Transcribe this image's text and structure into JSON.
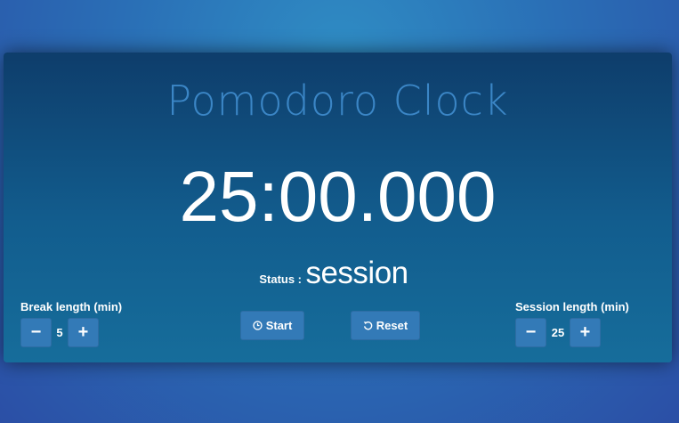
{
  "app": {
    "title": "Pomodoro Clock",
    "timer": "25:00.000"
  },
  "status": {
    "label": "Status :",
    "value": "session"
  },
  "break": {
    "label": "Break length (min)",
    "value": "5",
    "decrement_symbol": "−",
    "increment_symbol": "+"
  },
  "session": {
    "label": "Session length (min)",
    "value": "25",
    "decrement_symbol": "−",
    "increment_symbol": "+"
  },
  "controls": {
    "start_label": "Start",
    "start_icon": "clock-icon",
    "reset_label": "Reset",
    "reset_icon": "undo-icon"
  },
  "colors": {
    "title": "#3b86c6",
    "button": "#337ab7"
  }
}
